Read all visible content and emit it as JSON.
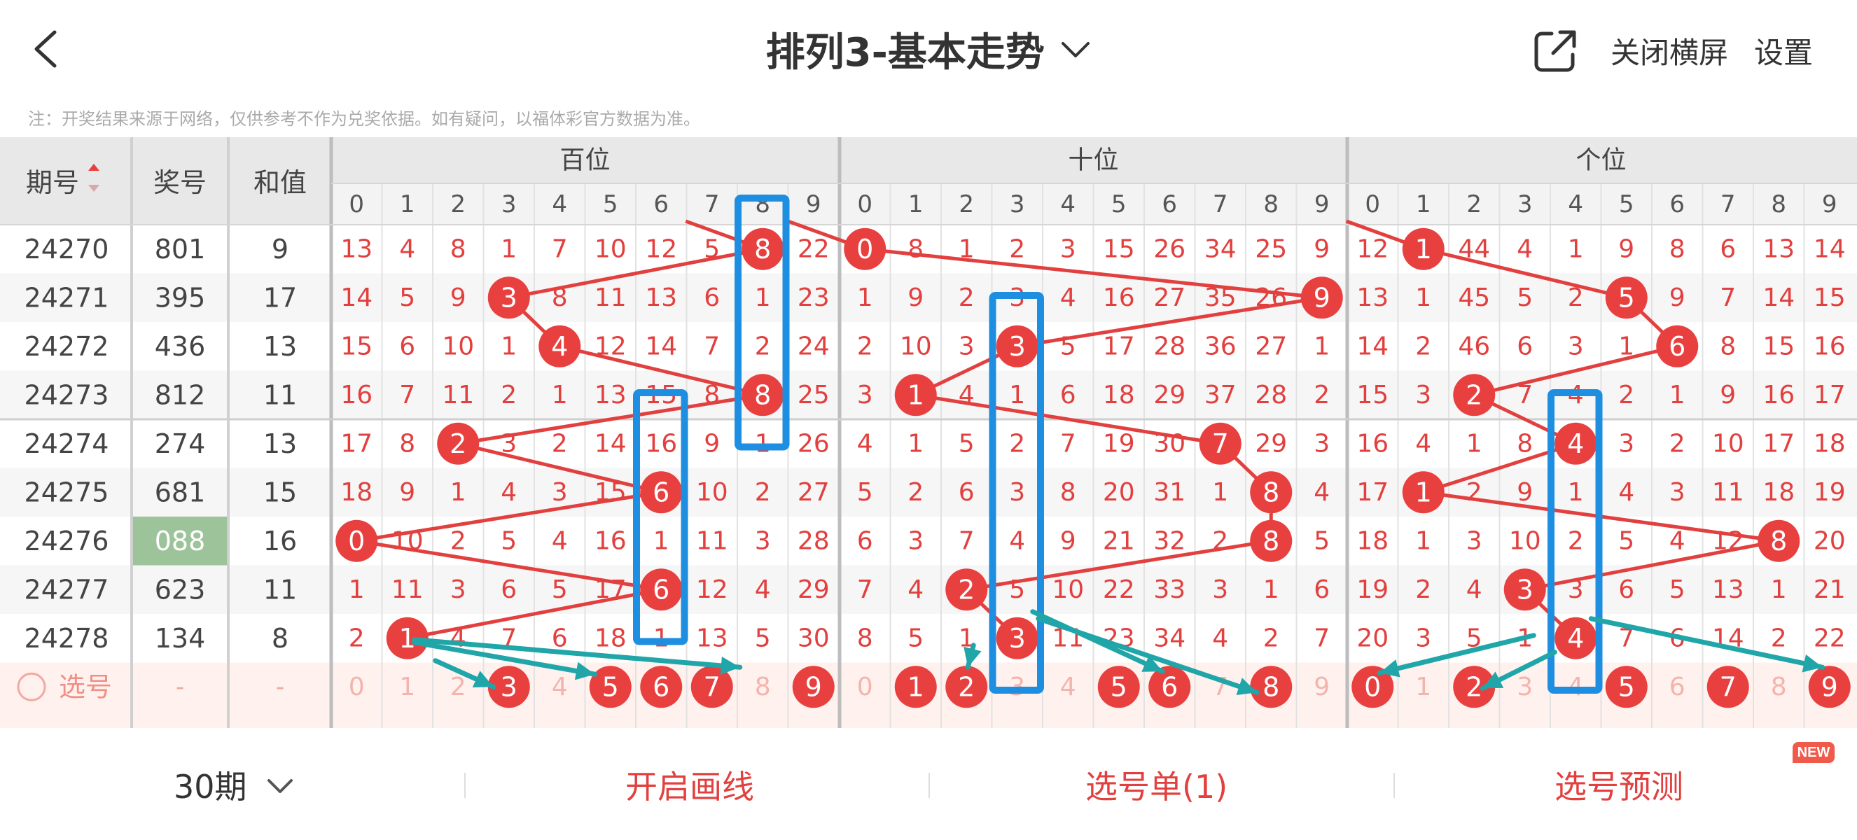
{
  "topbar": {
    "title": "排列3-基本走势",
    "close_landscape": "关闭横屏",
    "settings": "设置"
  },
  "note": "注：开奖结果来源于网络，仅供参考不作为兑奖依据。如有疑问，以福体彩官方数据为准。",
  "header": {
    "issue": "期号",
    "number": "奖号",
    "sum": "和值",
    "groups": [
      "百位",
      "十位",
      "个位"
    ],
    "digits": [
      "0",
      "1",
      "2",
      "3",
      "4",
      "5",
      "6",
      "7",
      "8",
      "9"
    ]
  },
  "rows": [
    {
      "issue": "24270",
      "num": "801",
      "sum": "9",
      "hundreds": [
        13,
        4,
        8,
        1,
        7,
        10,
        12,
        5,
        8,
        22
      ],
      "tens": [
        0,
        8,
        1,
        2,
        3,
        15,
        26,
        34,
        25,
        9
      ],
      "units": [
        12,
        1,
        44,
        4,
        1,
        9,
        8,
        6,
        13,
        14
      ],
      "hit": [
        8,
        0,
        1
      ]
    },
    {
      "issue": "24271",
      "num": "395",
      "sum": "17",
      "hundreds": [
        14,
        5,
        9,
        3,
        8,
        11,
        13,
        6,
        1,
        23
      ],
      "tens": [
        1,
        9,
        2,
        3,
        4,
        16,
        27,
        35,
        26,
        9
      ],
      "units": [
        13,
        1,
        45,
        5,
        2,
        5,
        9,
        7,
        14,
        15
      ],
      "hit": [
        3,
        9,
        5
      ]
    },
    {
      "issue": "24272",
      "num": "436",
      "sum": "13",
      "hundreds": [
        15,
        6,
        10,
        1,
        4,
        12,
        14,
        7,
        2,
        24
      ],
      "tens": [
        2,
        10,
        3,
        3,
        5,
        17,
        28,
        36,
        27,
        1
      ],
      "units": [
        14,
        2,
        46,
        6,
        3,
        1,
        6,
        8,
        15,
        16
      ],
      "hit": [
        4,
        3,
        6
      ]
    },
    {
      "issue": "24273",
      "num": "812",
      "sum": "11",
      "hundreds": [
        16,
        7,
        11,
        2,
        1,
        13,
        15,
        8,
        8,
        25
      ],
      "tens": [
        3,
        1,
        4,
        1,
        6,
        18,
        29,
        37,
        28,
        2
      ],
      "units": [
        15,
        3,
        2,
        7,
        4,
        2,
        1,
        9,
        16,
        17
      ],
      "hit": [
        8,
        1,
        2
      ]
    },
    {
      "issue": "24274",
      "num": "274",
      "sum": "13",
      "hundreds": [
        17,
        8,
        2,
        3,
        2,
        14,
        16,
        9,
        1,
        26
      ],
      "tens": [
        4,
        1,
        5,
        2,
        7,
        19,
        30,
        7,
        29,
        3
      ],
      "units": [
        16,
        4,
        1,
        8,
        4,
        3,
        2,
        10,
        17,
        18
      ],
      "hit": [
        2,
        7,
        4
      ]
    },
    {
      "issue": "24275",
      "num": "681",
      "sum": "15",
      "hundreds": [
        18,
        9,
        1,
        4,
        3,
        15,
        6,
        10,
        2,
        27
      ],
      "tens": [
        5,
        2,
        6,
        3,
        8,
        20,
        31,
        1,
        8,
        4
      ],
      "units": [
        17,
        1,
        2,
        9,
        1,
        4,
        3,
        11,
        18,
        19
      ],
      "hit": [
        6,
        8,
        1
      ]
    },
    {
      "issue": "24276",
      "num": "088",
      "sum": "16",
      "hundreds": [
        0,
        10,
        2,
        5,
        4,
        16,
        1,
        11,
        3,
        28
      ],
      "tens": [
        6,
        3,
        7,
        4,
        9,
        21,
        32,
        2,
        8,
        5
      ],
      "units": [
        18,
        1,
        3,
        10,
        2,
        5,
        4,
        12,
        8,
        20
      ],
      "hit": [
        0,
        8,
        8
      ]
    },
    {
      "issue": "24277",
      "num": "623",
      "sum": "11",
      "hundreds": [
        1,
        11,
        3,
        6,
        5,
        17,
        6,
        12,
        4,
        29
      ],
      "tens": [
        7,
        4,
        2,
        5,
        10,
        22,
        33,
        3,
        1,
        6
      ],
      "units": [
        19,
        2,
        4,
        3,
        3,
        6,
        5,
        13,
        1,
        21
      ],
      "hit": [
        6,
        2,
        3
      ]
    },
    {
      "issue": "24278",
      "num": "134",
      "sum": "8",
      "hundreds": [
        2,
        1,
        4,
        7,
        6,
        18,
        1,
        13,
        5,
        30
      ],
      "tens": [
        8,
        5,
        1,
        3,
        11,
        23,
        34,
        4,
        2,
        7
      ],
      "units": [
        20,
        3,
        5,
        1,
        4,
        7,
        6,
        14,
        2,
        22
      ],
      "hit": [
        1,
        3,
        4
      ]
    }
  ],
  "highlight_row": "24276",
  "select_row": {
    "label": "选号",
    "dash": "-",
    "selected": {
      "hundreds": [
        3,
        5,
        6,
        7,
        9
      ],
      "tens": [
        1,
        2,
        5,
        6,
        8
      ],
      "units": [
        0,
        2,
        5,
        7,
        9
      ]
    }
  },
  "footer": {
    "periods": "30期",
    "draw_line": "开启画线",
    "selection_list": "选号单(1)",
    "prediction": "选号预测",
    "new_badge": "NEW"
  },
  "colors": {
    "ball": "#e8403f",
    "number": "#e2403f",
    "line": "#e2403f",
    "box": "#1e8fe0",
    "arrow": "#20a6a8",
    "header_bg": "#e8e8e8",
    "highlight": "#9dc39a"
  }
}
